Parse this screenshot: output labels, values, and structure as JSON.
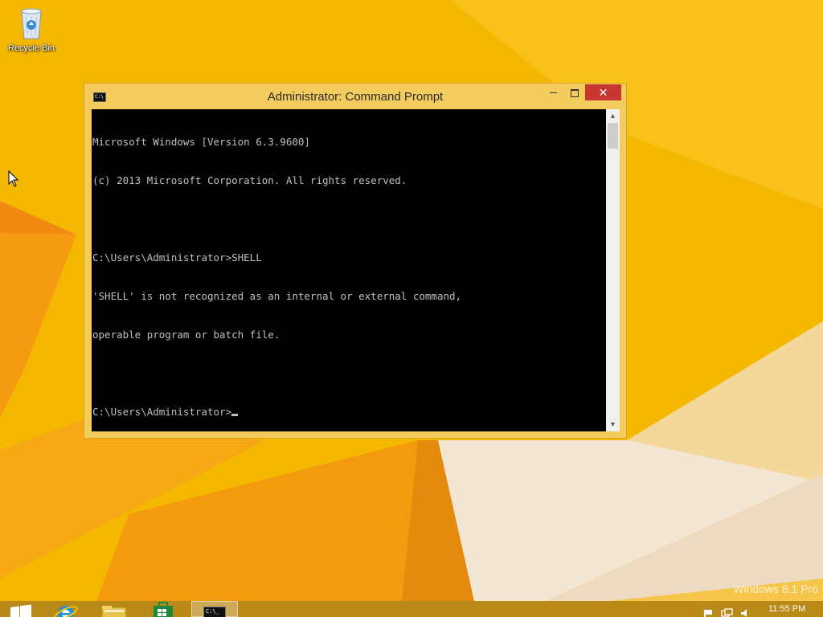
{
  "desktop": {
    "icons": [
      {
        "label": "Recycle Bin",
        "icon": "recycle-bin-icon"
      }
    ],
    "watermark": "Windows 8.1 Pro"
  },
  "window": {
    "title": "Administrator: Command Prompt",
    "icon": "command-prompt-icon",
    "controls": {
      "minimize": "minimize",
      "maximize": "maximize",
      "close": "✕"
    },
    "console_lines": [
      "Microsoft Windows [Version 6.3.9600]",
      "(c) 2013 Microsoft Corporation. All rights reserved.",
      "",
      "C:\\Users\\Administrator>SHELL",
      "'SHELL' is not recognized as an internal or external command,",
      "operable program or batch file.",
      "",
      "C:\\Users\\Administrator>"
    ],
    "scroll_up_glyph": "▲",
    "scroll_down_glyph": "▼"
  },
  "taskbar": {
    "items": [
      {
        "name": "start",
        "icon": "windows-logo-icon"
      },
      {
        "name": "internet-explorer",
        "icon": "internet-explorer-icon"
      },
      {
        "name": "file-explorer",
        "icon": "folder-icon"
      },
      {
        "name": "store",
        "icon": "store-icon"
      },
      {
        "name": "command-prompt",
        "icon": "command-prompt-icon",
        "active": true,
        "mini_text": "C:\\_"
      }
    ],
    "clock": "11:55 PM"
  },
  "colors": {
    "wallpaper": "#f3b400",
    "window_frame": "#f4cc5e",
    "console_bg": "#000000",
    "console_text": "#c0c0c0",
    "close_button": "#c7372f"
  }
}
